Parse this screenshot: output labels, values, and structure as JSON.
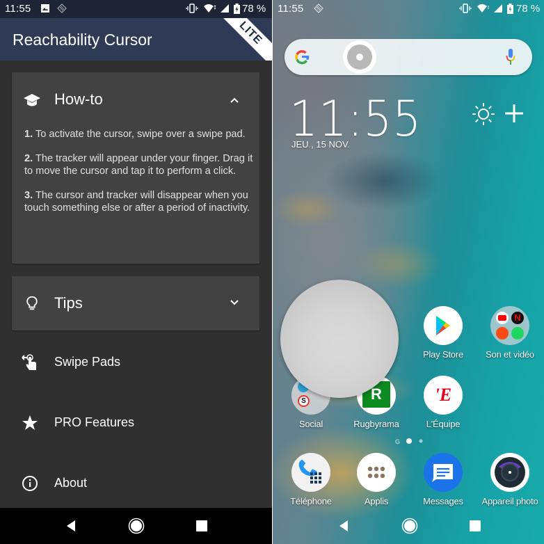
{
  "left_screen": {
    "status_bar": {
      "time": "11:55",
      "icons": [
        "image-icon",
        "sync-icon",
        "vibrate-icon",
        "wifi-icon",
        "signal-icon",
        "battery-charging-icon"
      ],
      "battery": "78 %"
    },
    "app_bar": {
      "title": "Reachability Cursor",
      "badge": "LITE",
      "color": "#2f3b55"
    },
    "howto": {
      "title": "How-to",
      "icon": "graduation-cap-icon",
      "expanded": true,
      "steps": [
        {
          "num": "1.",
          "text": " To activate the cursor, swipe over a swipe pad."
        },
        {
          "num": "2.",
          "text": " The tracker will appear under your finger. Drag it to move the cursor and tap it to perform a click."
        },
        {
          "num": "3.",
          "text": " The cursor and tracker will disappear when you touch something else or after a period of inactivity."
        }
      ]
    },
    "tips": {
      "title": "Tips",
      "icon": "lightbulb-icon",
      "expanded": false
    },
    "menu": [
      {
        "label": "Swipe Pads",
        "icon": "swipe-gesture-icon"
      },
      {
        "label": "PRO Features",
        "icon": "star-icon"
      },
      {
        "label": "About",
        "icon": "info-icon"
      }
    ],
    "nav": [
      "back",
      "home",
      "recents"
    ]
  },
  "right_screen": {
    "status_bar": {
      "time": "11:55",
      "icons": [
        "sync-icon",
        "vibrate-icon",
        "wifi-icon",
        "signal-icon",
        "battery-charging-icon"
      ],
      "battery": "78 %"
    },
    "search": {
      "logo": "G",
      "mic": "mic-icon"
    },
    "clock": {
      "time": "11:55",
      "date": "JEU., 15 NOV."
    },
    "apps": [
      {
        "name": "Play Store"
      },
      {
        "name": "Son et vidéo"
      },
      {
        "name": "Social"
      },
      {
        "name": "Rugbyrama"
      },
      {
        "name": "L'Équipe"
      }
    ],
    "folder_son_video": [
      "YouTube",
      "Netflix",
      "arte",
      "Spotify"
    ],
    "page_indicator": {
      "pages": 2,
      "current": 1
    },
    "dock": [
      {
        "name": "Téléphone"
      },
      {
        "name": "Applis"
      },
      {
        "name": "Messages"
      },
      {
        "name": "Appareil photo"
      }
    ],
    "nav": [
      "back",
      "home",
      "recents"
    ]
  }
}
